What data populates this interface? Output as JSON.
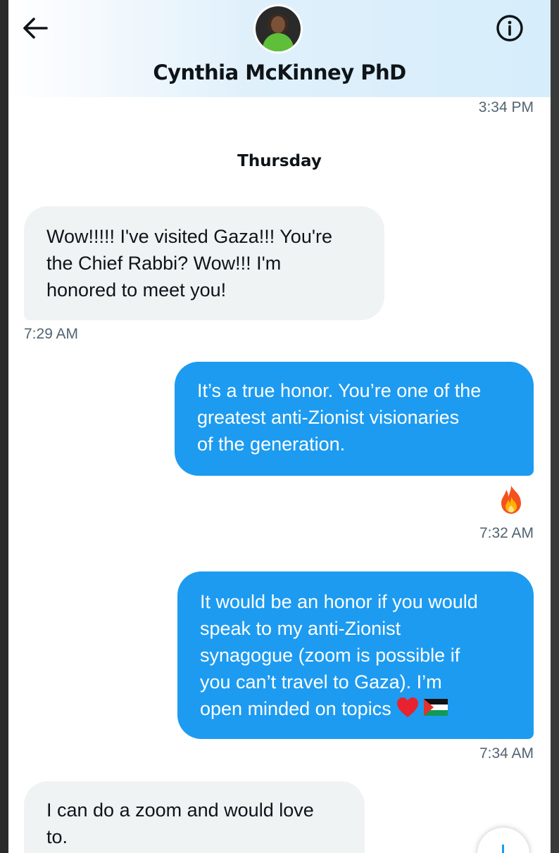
{
  "header": {
    "contact_name": "Cynthia McKinney PhD",
    "back_icon": "arrow-left-icon",
    "info_icon": "info-circle-icon"
  },
  "top_timestamp": "3:34 PM",
  "day_divider": "Thursday",
  "messages": [
    {
      "direction": "incoming",
      "lines": [
        "Wow!!!!! I've visited Gaza!!!  You're",
        "the Chief Rabbi?  Wow!!!  I'm",
        "honored to meet you!"
      ],
      "time": "7:29 AM"
    },
    {
      "direction": "outgoing",
      "lines": [
        "It’s a true honor. You’re one of the",
        "greatest anti-Zionist visionaries",
        "of the generation."
      ],
      "reaction": "fire-emoji",
      "time": "7:32 AM"
    },
    {
      "direction": "outgoing",
      "lines": [
        "It would be an honor if you would",
        "speak to my anti-Zionist",
        "synagogue (zoom is possible if",
        "you can’t travel to Gaza). I’m",
        "open minded on topics"
      ],
      "trailing_emojis": [
        "red-heart-emoji",
        "palestine-flag-emoji"
      ],
      "time": "7:34 AM"
    },
    {
      "direction": "incoming",
      "lines": [
        "I can do a zoom and would love",
        "to."
      ]
    }
  ],
  "colors": {
    "outgoing_bubble": "#1d9bf0",
    "incoming_bubble": "#eff3f4",
    "timestamp": "#536471",
    "header_tint": "#d6edfb"
  },
  "scroll_button_icon": "arrow-down-icon"
}
